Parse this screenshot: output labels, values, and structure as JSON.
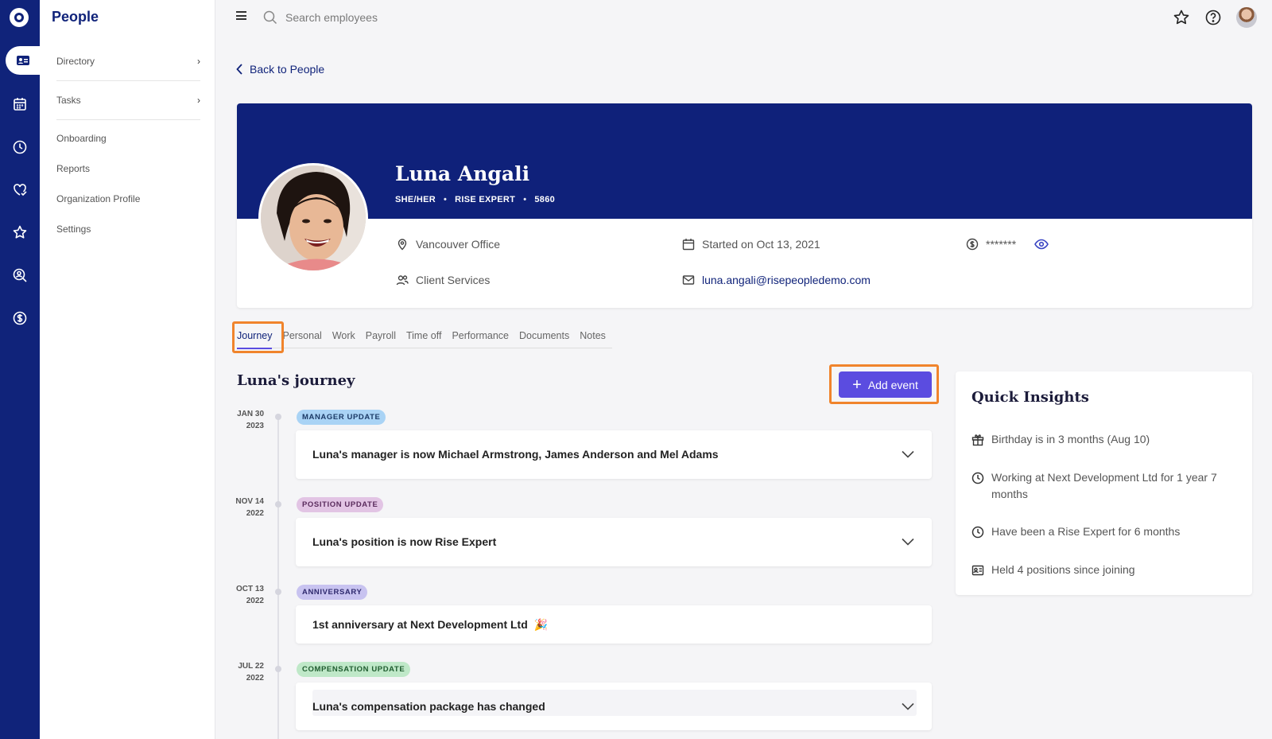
{
  "app": {
    "section_title": "People"
  },
  "rail": {
    "items": [
      "logo-icon",
      "people-card-icon",
      "calendar-icon",
      "clock-icon",
      "heart-hand-icon",
      "star-icon",
      "person-search-icon",
      "dollar-icon"
    ],
    "active": "people-card-icon"
  },
  "sidebar": {
    "items": [
      {
        "label": "Directory",
        "has_chevron": true
      },
      {
        "label": "Tasks",
        "has_chevron": true
      },
      {
        "label": "Onboarding",
        "has_chevron": false
      },
      {
        "label": "Reports",
        "has_chevron": false
      },
      {
        "label": "Organization Profile",
        "has_chevron": false
      },
      {
        "label": "Settings",
        "has_chevron": false
      }
    ]
  },
  "topbar": {
    "search_placeholder": "Search employees"
  },
  "back_link": "Back to People",
  "profile": {
    "name": "Luna Angali",
    "pronouns": "SHE/HER",
    "role": "RISE EXPERT",
    "employee_id": "5860",
    "office": "Vancouver Office",
    "department": "Client Services",
    "start_date": "Started on Oct 13, 2021",
    "email": "luna.angali@risepeopledemo.com",
    "salary_masked": "*******"
  },
  "tabs": {
    "items": [
      "Journey",
      "Personal",
      "Work",
      "Payroll",
      "Time off",
      "Performance",
      "Documents",
      "Notes"
    ],
    "active": "Journey"
  },
  "journey": {
    "title": "Luna's journey",
    "add_event_label": "Add event",
    "events": [
      {
        "date_month_day": "JAN 30",
        "date_year": "2023",
        "badge": "MANAGER UPDATE",
        "text": "Luna's manager is now Michael Armstrong, James Anderson and Mel Adams",
        "expandable": true
      },
      {
        "date_month_day": "NOV 14",
        "date_year": "2022",
        "badge": "POSITION UPDATE",
        "text": "Luna's position is now Rise Expert",
        "expandable": true
      },
      {
        "date_month_day": "OCT 13",
        "date_year": "2022",
        "badge": "ANNIVERSARY",
        "text": "1st anniversary at Next Development Ltd",
        "emoji": "🎉",
        "expandable": false
      },
      {
        "date_month_day": "JUL 22",
        "date_year": "2022",
        "badge": "COMPENSATION UPDATE",
        "text": "Luna's compensation package has changed",
        "expandable": true
      }
    ]
  },
  "insights": {
    "title": "Quick Insights",
    "items": [
      {
        "icon": "gift-icon",
        "text": "Birthday is in 3 months (Aug 10)"
      },
      {
        "icon": "clock-icon",
        "text": "Working at Next Development Ltd for 1 year 7 months"
      },
      {
        "icon": "clock-icon",
        "text": "Have been a Rise Expert for 6 months"
      },
      {
        "icon": "id-card-icon",
        "text": "Held 4 positions since joining"
      }
    ]
  },
  "colors": {
    "brand_navy": "#10237a",
    "accent_purple": "#5b4ce0",
    "highlight_orange": "#f0842c"
  }
}
